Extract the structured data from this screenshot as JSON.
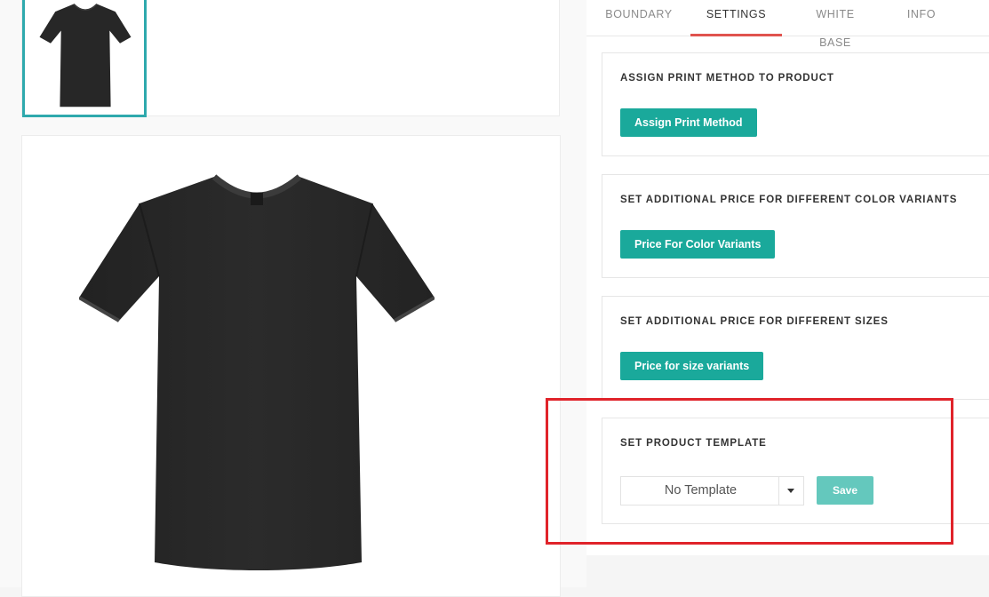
{
  "tabs": [
    {
      "label": "BOUNDARY"
    },
    {
      "label": "SETTINGS"
    },
    {
      "label": "WHITE BASE"
    },
    {
      "label": "INFO"
    }
  ],
  "active_tab": "SETTINGS",
  "sections": {
    "print_method": {
      "title": "ASSIGN PRINT METHOD TO PRODUCT",
      "button": "Assign Print Method"
    },
    "color_variants": {
      "title": "SET ADDITIONAL PRICE FOR DIFFERENT COLOR VARIANTS",
      "button": "Price For Color Variants"
    },
    "size_variants": {
      "title": "SET ADDITIONAL PRICE FOR DIFFERENT SIZES",
      "button": "Price for size variants"
    },
    "product_template": {
      "title": "SET PRODUCT TEMPLATE",
      "select_value": "No Template",
      "save": "Save"
    }
  },
  "colors": {
    "accent_teal": "#1aa99b",
    "save_teal_disabled": "#64c8bd",
    "active_tab_underline": "#e0534e",
    "highlight_red": "#e0232a",
    "tshirt": "#272727"
  },
  "icons": {
    "dropdown": "chevron-down-icon"
  }
}
